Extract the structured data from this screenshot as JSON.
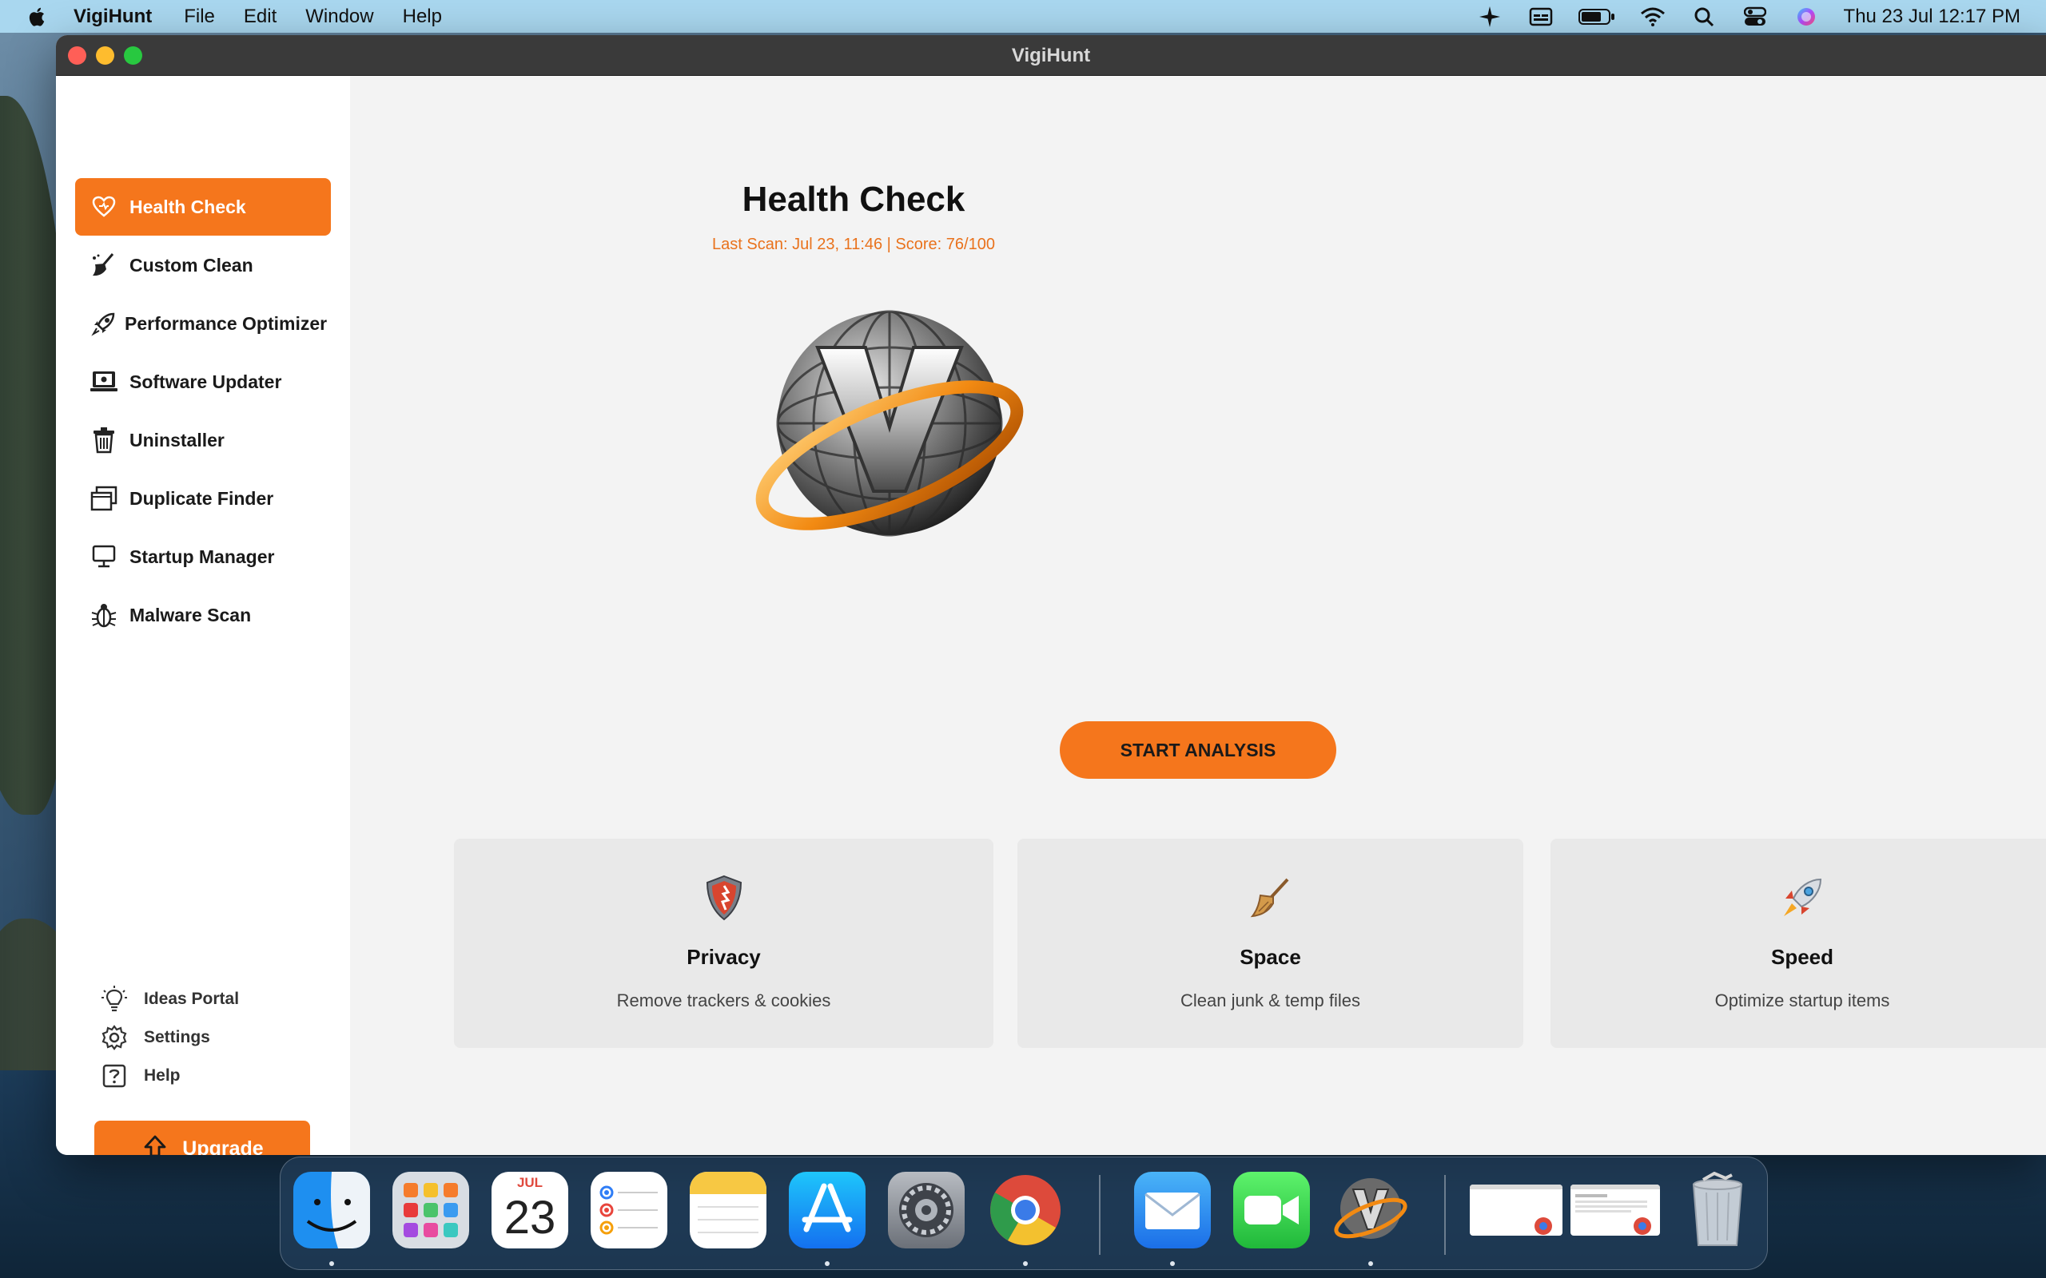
{
  "menubar": {
    "app_name": "VigiHunt",
    "menus": [
      "File",
      "Edit",
      "Window",
      "Help"
    ],
    "clock": "Thu 23 Jul  12:17 PM",
    "status_icons": [
      "sparkle-icon",
      "menu-extra-icon",
      "battery-icon",
      "wifi-icon",
      "spotlight-search-icon",
      "control-center-icon",
      "siri-icon"
    ]
  },
  "window": {
    "title": "VigiHunt"
  },
  "sidebar": {
    "items": [
      {
        "label": "Health Check",
        "icon": "heart-icon",
        "active": true
      },
      {
        "label": "Custom Clean",
        "icon": "broom-icon"
      },
      {
        "label": "Performance Optimizer",
        "icon": "rocket-icon"
      },
      {
        "label": "Software Updater",
        "icon": "laptop-icon"
      },
      {
        "label": "Uninstaller",
        "icon": "trash-icon"
      },
      {
        "label": "Duplicate Finder",
        "icon": "duplicate-icon"
      },
      {
        "label": "Startup Manager",
        "icon": "monitor-icon"
      },
      {
        "label": "Malware Scan",
        "icon": "bug-icon"
      }
    ],
    "utility": [
      {
        "label": "Ideas Portal",
        "icon": "lightbulb-icon"
      },
      {
        "label": "Settings",
        "icon": "gear-icon"
      },
      {
        "label": "Help",
        "icon": "question-icon"
      }
    ],
    "upgrade_label": "Upgrade"
  },
  "main": {
    "title": "Health Check",
    "scan_info": "Last Scan: Jul 23, 11:46  |  Score: 76/100",
    "start_button": "START ANALYSIS",
    "cards": [
      {
        "title": "Privacy",
        "desc": "Remove trackers & cookies",
        "icon": "shield-icon"
      },
      {
        "title": "Space",
        "desc": "Clean junk & temp files",
        "icon": "broom-icon"
      },
      {
        "title": "Speed",
        "desc": "Optimize startup items",
        "icon": "rocket-icon"
      }
    ]
  },
  "dock": {
    "calendar_month": "JUL",
    "calendar_day": "23",
    "apps": [
      "Finder",
      "Launchpad",
      "Calendar",
      "Reminders",
      "Notes",
      "App Store",
      "System Settings",
      "Chrome",
      "Mail",
      "FaceTime",
      "VigiHunt"
    ]
  },
  "colors": {
    "accent": "#f5761c",
    "menubar": "#a9d7ef",
    "titlebar": "#3a3a3a"
  }
}
